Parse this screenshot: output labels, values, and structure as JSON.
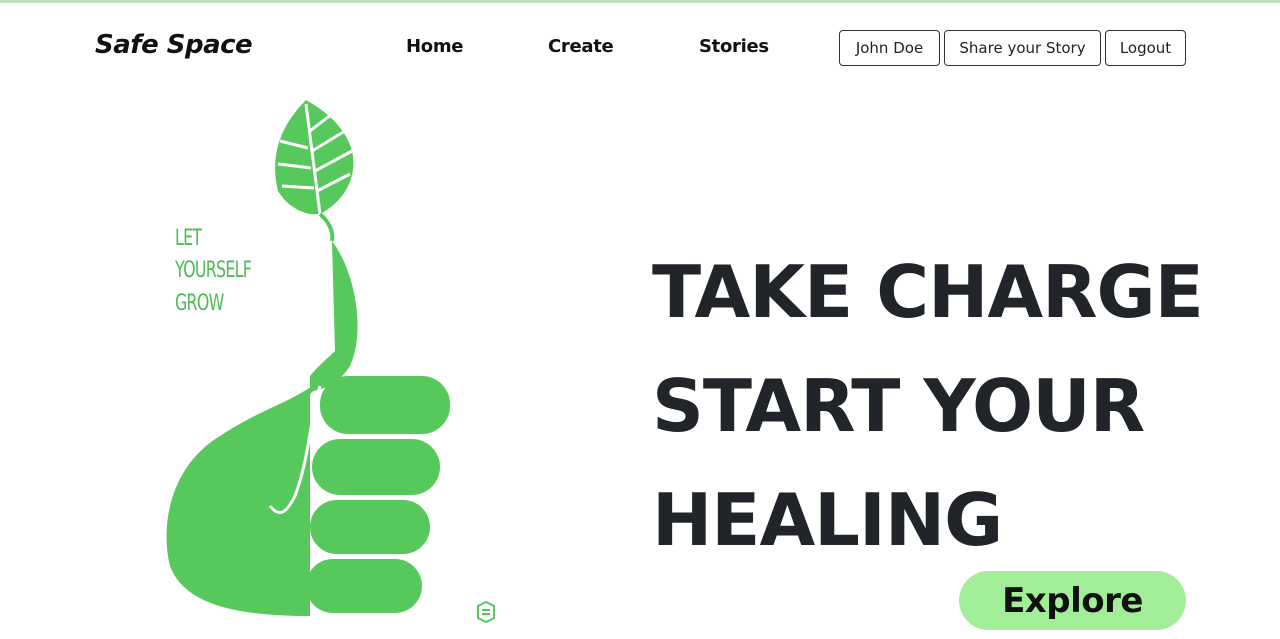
{
  "nav": {
    "brand": "Safe Space",
    "links": [
      "Home",
      "Create",
      "Stories"
    ],
    "buttons": {
      "user": "John Doe",
      "share": "Share your Story",
      "logout": "Logout"
    }
  },
  "hero": {
    "image": {
      "text": [
        "LET",
        "YOURSELF",
        "GROW"
      ],
      "icon": "thumbs-up-leaf-icon",
      "color": "#57c95c"
    },
    "headline": [
      "TAKE CHARGE",
      "START YOUR",
      "HEALING"
    ],
    "cta": "Explore"
  },
  "colors": {
    "accent": "#a2ee98",
    "text": "#212529",
    "top_line": "#bfe3c0"
  }
}
